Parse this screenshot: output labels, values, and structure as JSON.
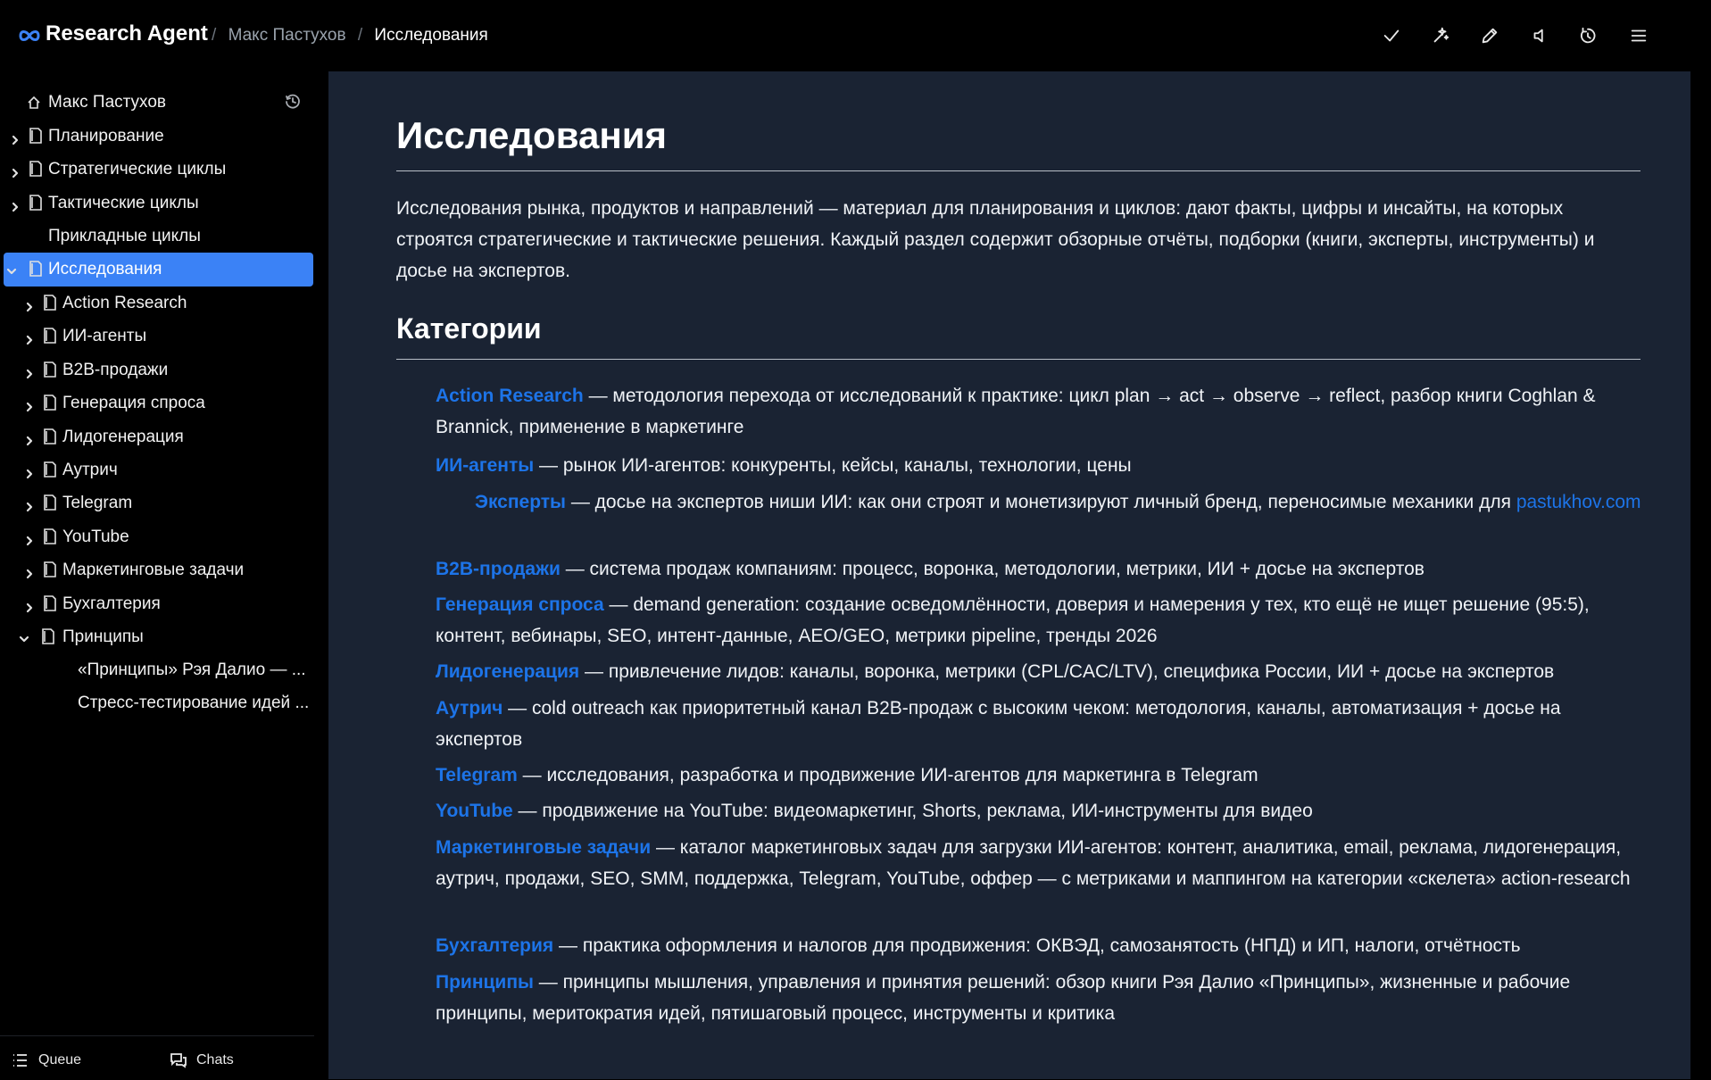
{
  "header": {
    "brand": "Research Agent",
    "breadcrumb": [
      "Макс Пастухов",
      "Исследования"
    ],
    "separator": "/",
    "actions": [
      "check-icon",
      "sparkles-icon",
      "pencil-icon",
      "speaker-icon",
      "rotate-icon",
      "menu-icon"
    ]
  },
  "sidebar": {
    "root": "Макс Пастухов",
    "items": [
      {
        "label": "Планирование"
      },
      {
        "label": "Стратегические циклы"
      },
      {
        "label": "Тактические циклы"
      },
      {
        "label": "Прикладные циклы"
      },
      {
        "label": "Исследования",
        "active": true,
        "expanded": true
      },
      {
        "label": "Action Research"
      },
      {
        "label": "ИИ-агенты"
      },
      {
        "label": "B2B-продажи"
      },
      {
        "label": "Генерация спроса"
      },
      {
        "label": "Лидогенерация"
      },
      {
        "label": "Аутрич"
      },
      {
        "label": "Telegram"
      },
      {
        "label": "YouTube"
      },
      {
        "label": "Маркетинговые задачи"
      },
      {
        "label": "Бухгалтерия"
      },
      {
        "label": "Принципы",
        "expanded": true
      },
      {
        "label": "«Принципы» Рэя Далио — ..."
      },
      {
        "label": "Стресс-тестирование идей ..."
      }
    ],
    "footer": {
      "queue": "Queue",
      "chats": "Chats"
    }
  },
  "main": {
    "title": "Исследования",
    "intro": "Исследования рынка, продуктов и направлений — материал для планирования и циклов: дают факты, цифры и инсайты, на которых строятся стратегические и тактические решения. Каждый раздел содержит обзорные отчёты, подборки (книги, эксперты, инструменты) и досье на экспертов.",
    "section_title": "Категории",
    "categories": [
      {
        "link": "Action Research",
        "text": " — методология перехода от исследований к практике: цикл plan → act → observe → reflect, разбор книги Coghlan & Brannick, применение в маркетинге"
      },
      {
        "link": "ИИ-агенты",
        "text": " — рынок ИИ-агентов: конкуренты, кейсы, каналы, технологии, цены"
      },
      {
        "link": "Эксперты",
        "text": " — досье на экспертов ниши ИИ: как они строят и монетизируют личный бренд, переносимые механики для ",
        "link2": "pastukhov.com"
      },
      {
        "link": "B2B-продажи",
        "text": " — система продаж компаниям: процесс, воронка, методологии, метрики, ИИ + досье на экспертов"
      },
      {
        "link": "Генерация спроса",
        "text": " — demand generation: создание осведомлённости, доверия и намерения у тех, кто ещё не ищет решение (95:5), контент, вебинары, SEO, интент-данные, AEO/GEO, метрики pipeline, тренды 2026"
      },
      {
        "link": "Лидогенерация",
        "text": " — привлечение лидов: каналы, воронка, метрики (CPL/CAC/LTV), специфика России, ИИ + досье на экспертов"
      },
      {
        "link": "Аутрич",
        "text": " — cold outreach как приоритетный канал B2B-продаж с высоким чеком: методология, каналы, автоматизация + досье на экспертов"
      },
      {
        "link": "Telegram",
        "text": " — исследования, разработка и продвижение ИИ-агентов для маркетинга в Telegram"
      },
      {
        "link": "YouTube",
        "text": " — продвижение на YouTube: видеомаркетинг, Shorts, реклама, ИИ-инструменты для видео"
      },
      {
        "link": "Маркетинговые задачи",
        "text": " — каталог маркетинговых задач для загрузки ИИ-агентов: контент, аналитика, email, реклама, лидогенерация, аутрич, продажи, SEO, SMM, поддержка, Telegram, YouTube, оффер — с метриками и маппингом на категории «скелета» action-research"
      },
      {
        "link": "Бухгалтерия",
        "text": " — практика оформления и налогов для продвижения: ОКВЭД, самозанятость (НПД) и ИП, налоги, отчётность"
      },
      {
        "link": "Принципы",
        "text": " — принципы мышления, управления и принятия решений: обзор книги Рэя Далио «Принципы», жизненные и рабочие принципы, меритократия идей, пятишаговый процесс, инструменты и критика"
      }
    ]
  },
  "colors": {
    "accent": "#3b82f6",
    "link": "#1d74e8",
    "content_bg": "#1a2333",
    "app_bg": "#000000"
  }
}
